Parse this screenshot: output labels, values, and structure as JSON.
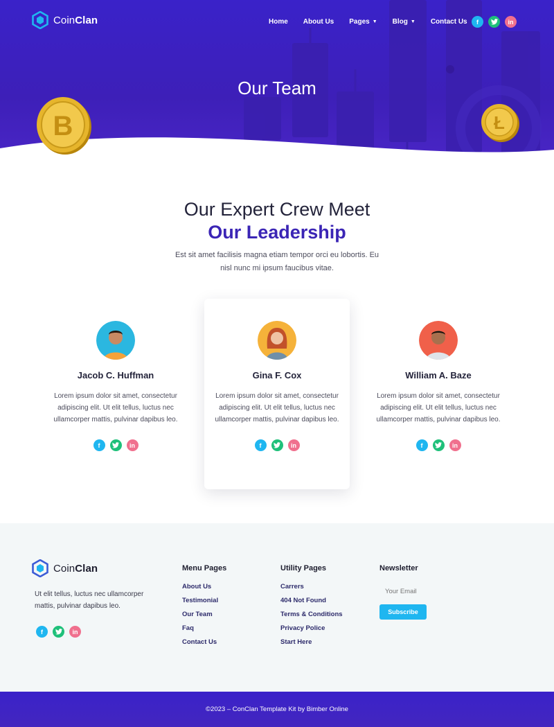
{
  "brand": {
    "name_light": "Coin",
    "name_bold": "Clan"
  },
  "nav": {
    "items": [
      {
        "label": "Home",
        "dropdown": false
      },
      {
        "label": "About Us",
        "dropdown": false
      },
      {
        "label": "Pages",
        "dropdown": true
      },
      {
        "label": "Blog",
        "dropdown": true
      },
      {
        "label": "Contact Us",
        "dropdown": false
      }
    ],
    "social": [
      "facebook-icon",
      "twitter-icon",
      "linkedin-icon"
    ]
  },
  "hero": {
    "title": "Our Team"
  },
  "section": {
    "heading_light": "Our Expert Crew Meet",
    "heading_bold": "Our Leadership",
    "description": "Est sit amet facilisis magna etiam tempor orci eu lobortis. Eu nisl nunc mi ipsum faucibus vitae."
  },
  "team": [
    {
      "name": "Jacob C. Huffman",
      "bio": "Lorem ipsum dolor sit amet, consectetur adipiscing elit. Ut elit tellus, luctus nec ullamcorper mattis, pulvinar dapibus leo.",
      "avatar_bg": "#2bb7e0"
    },
    {
      "name": "Gina F. Cox",
      "bio": "Lorem ipsum dolor sit amet, consectetur adipiscing elit. Ut elit tellus, luctus nec ullamcorper mattis, pulvinar dapibus leo.",
      "avatar_bg": "#f5b23a"
    },
    {
      "name": "William A. Baze",
      "bio": "Lorem ipsum dolor sit amet, consectetur adipiscing elit. Ut elit tellus, luctus nec ullamcorper mattis, pulvinar dapibus leo.",
      "avatar_bg": "#f0604a"
    }
  ],
  "footer": {
    "about": "Ut elit tellus, luctus nec ullamcorper mattis, pulvinar dapibus leo.",
    "menu_pages": {
      "title": "Menu Pages",
      "links": [
        "About Us",
        "Testimonial",
        "Our Team",
        "Faq",
        "Contact Us"
      ]
    },
    "utility_pages": {
      "title": "Utility Pages",
      "links": [
        "Carrers",
        "404 Not Found",
        "Terms & Conditions",
        "Privacy Police",
        "Start Here"
      ]
    },
    "newsletter": {
      "title": "Newsletter",
      "placeholder": "Your Email",
      "button": "Subscribe"
    },
    "copyright": "©2023 – ConClan Template Kit by Bimber Online"
  },
  "colors": {
    "primary": "#3b25b5",
    "accent": "#1fb6f0",
    "twitter": "#1fc07a",
    "linkedin": "#f0708e"
  }
}
